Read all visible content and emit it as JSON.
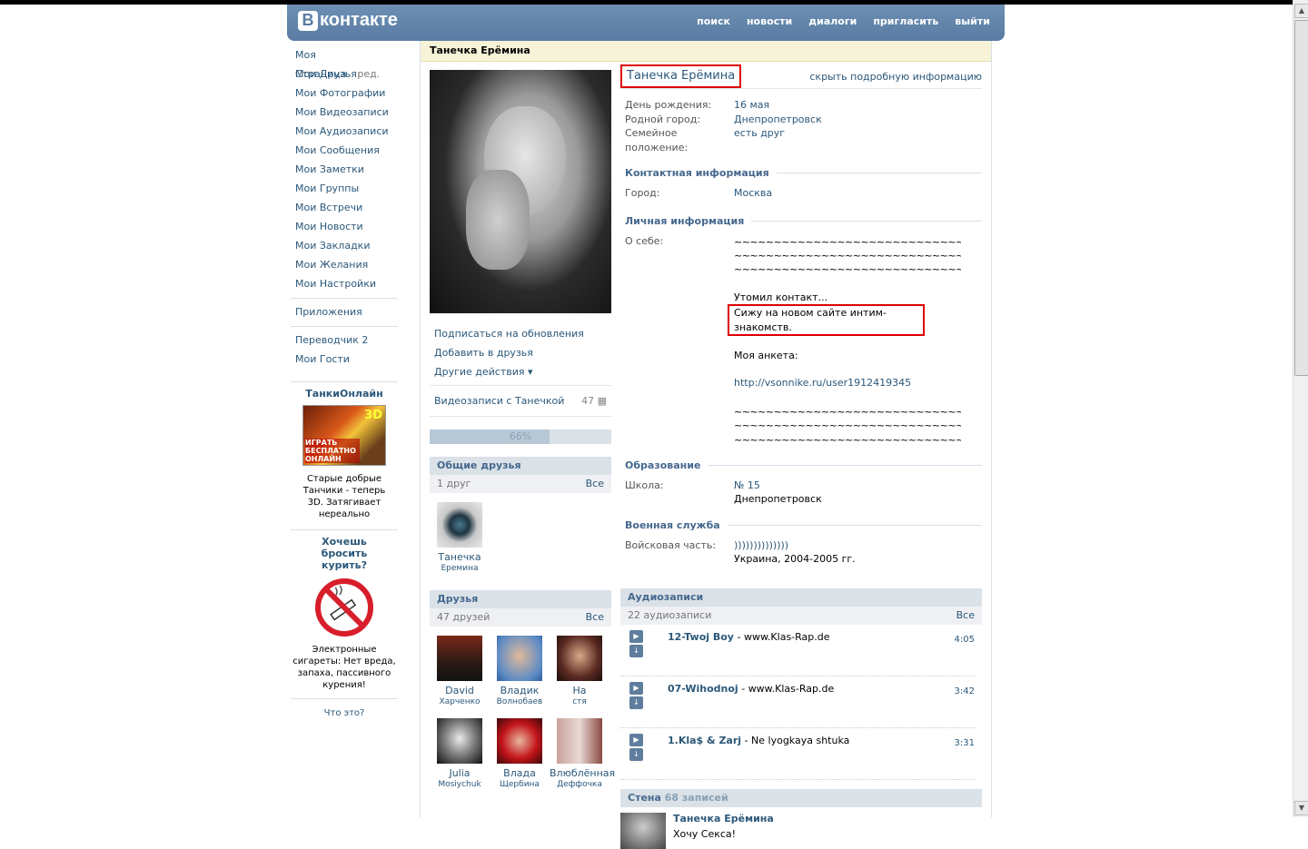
{
  "header": {
    "logo_letter": "В",
    "logo_text": "контакте",
    "nav": [
      "поиск",
      "новости",
      "диалоги",
      "пригласить",
      "выйти"
    ]
  },
  "leftnav": {
    "items": [
      "Моя Страница",
      "Мои Друзья",
      "Мои Фотографии",
      "Мои Видеозаписи",
      "Мои Аудиозаписи",
      "Мои Сообщения",
      "Мои Заметки",
      "Мои Группы",
      "Мои Встречи",
      "Мои Новости",
      "Мои Закладки",
      "Мои Желания",
      "Мои Настройки"
    ],
    "edit_label": "ред.",
    "apps": "Приложения",
    "extra": [
      "Переводчик 2",
      "Мои Гости"
    ]
  },
  "ads": {
    "tanki": {
      "title": "ТанкиОнлайн",
      "img_3d": "3D",
      "img_text": "ИГРАТЬ БЕСПЛАТНО ОНЛАЙН",
      "desc": "Старые добрые Танчики - теперь 3D. Затягивает нереально"
    },
    "smoke": {
      "title": "Хочешь бросить курить?",
      "desc": "Электронные сигареты: Нет вреда, запаха, пассивного курения!"
    },
    "what": "Что это?"
  },
  "page_title": "Танечка Ерёмина",
  "actions": {
    "subscribe": "Подписаться на обновления",
    "add_friend": "Добавить в друзья",
    "other": "Другие действия",
    "videos": "Видеозаписи с Танечкой",
    "videos_count": "47"
  },
  "progress": {
    "label": "66%",
    "value": 0.66
  },
  "mutual": {
    "title": "Общие друзья",
    "count": "1 друг",
    "all": "Все",
    "friends": [
      {
        "first": "Танечка",
        "last": "Еремина"
      }
    ]
  },
  "friends": {
    "title": "Друзья",
    "count": "47 друзей",
    "all": "Все",
    "items": [
      {
        "first": "David",
        "last": "Харченко"
      },
      {
        "first": "Владик",
        "last": "Волнобаев"
      },
      {
        "first": "На",
        "last": "стя"
      },
      {
        "first": "Julia",
        "last": "Mosiychuk"
      },
      {
        "first": "Влада",
        "last": "Щербина"
      },
      {
        "first": "Влюблённая",
        "last": "Деффочка"
      }
    ]
  },
  "profile": {
    "name": "Танечка Ерёмина",
    "hide_link": "скрыть подробную информацию",
    "basic": [
      {
        "k": "День рождения:",
        "v": "16 мая"
      },
      {
        "k": "Родной город:",
        "v": "Днепропетровск"
      },
      {
        "k": "Семейное положение:",
        "v": "есть друг"
      }
    ],
    "contact_title": "Контактная информация",
    "city_k": "Город:",
    "city_v": "Москва",
    "personal_title": "Личная информация",
    "about_k": "О себе:",
    "tilde": "~~~~~~~~~~~~~~~~~~~~~~~~~~~~~~~~~~~~~~~~~~~~~~~~~~~~~~~~~~~~~~~~~~~~~~~~~~~~~~~~~~~~~~~~~~~~~~~~~~~~~~~~~~~~~~~~~~~~~~~~~~~~~~~~~~~~~~~~~~~~~~~~~~~~~~~~~~~~",
    "about_1": "Утомил контакт...",
    "about_2": "Сижу на новом сайте интим-знакомств.",
    "about_3": "Моя анкета:",
    "about_link": "http://vsonnike.ru/user1912419345",
    "edu_title": "Образование",
    "school_k": "Школа:",
    "school_v": "№ 15",
    "school_city": "Днепропетровск",
    "mil_title": "Военная служба",
    "mil_k": "Войсковая часть:",
    "mil_v": "))))))))))))))",
    "mil_v2": "Украина, 2004-2005 гг."
  },
  "audio": {
    "title": "Аудиозаписи",
    "count": "22 аудиозаписи",
    "all": "Все",
    "tracks": [
      {
        "artist": "12-Twoj Boy",
        "title": "www.Klas-Rap.de",
        "dur": "4:05"
      },
      {
        "artist": "07-Wihodnoj",
        "title": "www.Klas-Rap.de",
        "dur": "3:42"
      },
      {
        "artist": "1.Kla$ & Zarj",
        "title": "Ne lyogkaya shtuka",
        "dur": "3:31"
      }
    ]
  },
  "wall": {
    "title": "Стена",
    "count": "68 записей",
    "post_author": "Танечка Ерёмина",
    "post_text": "Хочу Секса!"
  }
}
